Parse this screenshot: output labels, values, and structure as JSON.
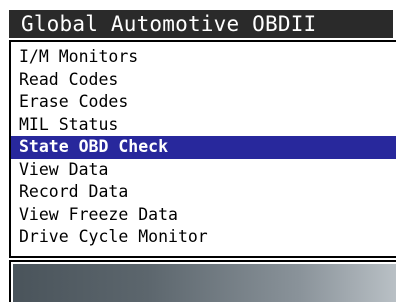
{
  "header": {
    "title": "Global Automotive OBDII"
  },
  "menu": {
    "items": [
      {
        "label": "I/M Monitors",
        "selected": false
      },
      {
        "label": "Read Codes",
        "selected": false
      },
      {
        "label": "Erase Codes",
        "selected": false
      },
      {
        "label": "MIL Status",
        "selected": false
      },
      {
        "label": "State OBD Check",
        "selected": true
      },
      {
        "label": "View Data",
        "selected": false
      },
      {
        "label": "Record Data",
        "selected": false
      },
      {
        "label": "View Freeze Data",
        "selected": false
      },
      {
        "label": "Drive Cycle Monitor",
        "selected": false
      }
    ]
  },
  "colors": {
    "title_bg": "#2a2a2a",
    "highlight": "#28289c",
    "border": "#000000"
  }
}
